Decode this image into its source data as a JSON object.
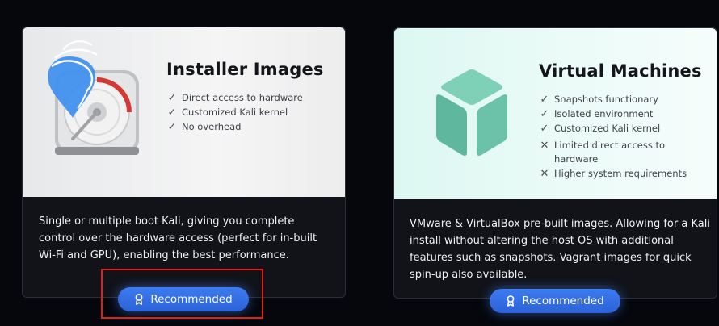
{
  "cards": [
    {
      "title": "Installer Images",
      "features": [
        {
          "mark": "✓",
          "text": "Direct access to hardware"
        },
        {
          "mark": "✓",
          "text": "Customized Kali kernel"
        },
        {
          "mark": "✓",
          "text": "No overhead"
        }
      ],
      "description": "Single or multiple boot Kali, giving you complete control over the hardware access (perfect for in-built Wi-Fi and GPU), enabling the best performance.",
      "button_label": "Recommended",
      "icon": "kali-installer-disk-icon"
    },
    {
      "title": "Virtual Machines",
      "features": [
        {
          "mark": "✓",
          "text": "Snapshots functionary"
        },
        {
          "mark": "✓",
          "text": "Isolated environment"
        },
        {
          "mark": "✓",
          "text": "Customized Kali kernel"
        },
        {
          "mark": "✕",
          "text": "Limited direct access to hardware"
        },
        {
          "mark": "✕",
          "text": "Higher system requirements"
        }
      ],
      "description": "VMware & VirtualBox pre-built images. Allowing for a Kali install without altering the host OS with additional features such as snapshots. Vagrant images for quick spin-up also available.",
      "button_label": "Recommended",
      "icon": "virtual-machine-cube-icon"
    }
  ],
  "colors": {
    "background": "#05070d",
    "button": "#3a78ee",
    "highlight": "#e0211b",
    "vm_accent": "#6cc2a8"
  }
}
